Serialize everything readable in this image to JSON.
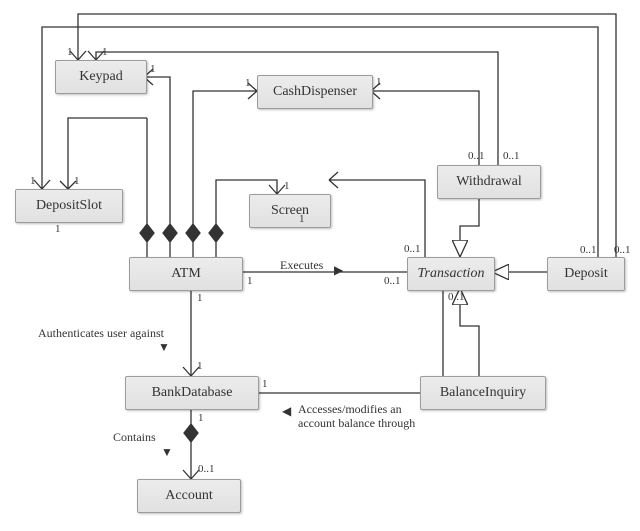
{
  "diagram": {
    "type": "UML class diagram",
    "subject": "ATM system"
  },
  "nodes": {
    "keypad": "Keypad",
    "cashDispenser": "CashDispenser",
    "depositSlot": "DepositSlot",
    "screen": "Screen",
    "withdrawal": "Withdrawal",
    "atm": "ATM",
    "transaction": "Transaction",
    "deposit": "Deposit",
    "bankDatabase": "BankDatabase",
    "balanceInquiry": "BalanceInquiry",
    "account": "Account"
  },
  "relations": {
    "executes": "Executes",
    "authenticates": "Authenticates user against",
    "accesses": "Accesses/modifies an\naccount balance through",
    "accesses_l1": "Accesses/modifies an",
    "accesses_l2": "account balance through",
    "contains": "Contains"
  },
  "mult": {
    "one": "1",
    "zeroOne": "0..1"
  },
  "relation_list": [
    {
      "from": "ATM",
      "to": "Keypad",
      "type": "composition",
      "mult": {
        "ATM": "1",
        "Keypad": "1"
      }
    },
    {
      "from": "ATM",
      "to": "CashDispenser",
      "type": "composition",
      "mult": {
        "ATM": "1",
        "CashDispenser": "1"
      }
    },
    {
      "from": "ATM",
      "to": "DepositSlot",
      "type": "composition",
      "mult": {
        "ATM": "1",
        "DepositSlot": "1"
      }
    },
    {
      "from": "ATM",
      "to": "Screen",
      "type": "composition",
      "mult": {
        "ATM": "1",
        "Screen": "1"
      }
    },
    {
      "from": "ATM",
      "to": "Transaction",
      "type": "association",
      "name": "Executes",
      "mult": {
        "ATM": "1",
        "Transaction": "0..1"
      }
    },
    {
      "from": "ATM",
      "to": "BankDatabase",
      "type": "association",
      "name": "Authenticates user against",
      "mult": {
        "ATM": "1",
        "BankDatabase": "1"
      }
    },
    {
      "from": "BankDatabase",
      "to": "Account",
      "type": "composition",
      "name": "Contains",
      "mult": {
        "BankDatabase": "1",
        "Account": "0..1"
      }
    },
    {
      "from": "Transaction",
      "to": "BankDatabase",
      "type": "association",
      "name": "Accesses/modifies an account balance through",
      "mult": {
        "Transaction": "0..1",
        "BankDatabase": "1"
      }
    },
    {
      "from": "Transaction",
      "to": "Screen",
      "type": "association",
      "mult": {
        "Transaction": "0..1",
        "Screen": "1"
      }
    },
    {
      "from": "Withdrawal",
      "to": "Transaction",
      "type": "generalization"
    },
    {
      "from": "Deposit",
      "to": "Transaction",
      "type": "generalization"
    },
    {
      "from": "BalanceInquiry",
      "to": "Transaction",
      "type": "generalization"
    },
    {
      "from": "Withdrawal",
      "to": "Keypad",
      "type": "association",
      "mult": {
        "Withdrawal": "0..1",
        "Keypad": "1"
      }
    },
    {
      "from": "Withdrawal",
      "to": "CashDispenser",
      "type": "association",
      "mult": {
        "Withdrawal": "0..1",
        "CashDispenser": "1"
      }
    },
    {
      "from": "Deposit",
      "to": "Keypad",
      "type": "association",
      "mult": {
        "Deposit": "0..1",
        "Keypad": "1"
      }
    },
    {
      "from": "Deposit",
      "to": "DepositSlot",
      "type": "association",
      "mult": {
        "Deposit": "0..1",
        "DepositSlot": "1"
      }
    }
  ]
}
